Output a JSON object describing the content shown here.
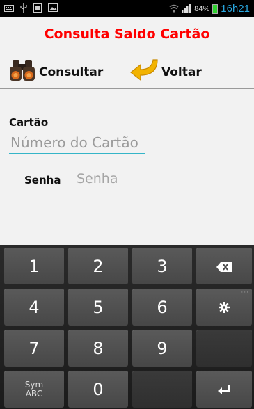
{
  "status_bar": {
    "battery_percent": "84%",
    "time": "16h21"
  },
  "app": {
    "title": "Consulta Saldo Cartão",
    "toolbar": {
      "consultar_label": "Consultar",
      "voltar_label": "Voltar"
    },
    "form": {
      "cartao_label": "Cartão",
      "cartao_placeholder": "Número do Cartão",
      "senha_label": "Senha",
      "senha_placeholder": "Senha"
    }
  },
  "keyboard": {
    "keys": {
      "k1": "1",
      "k2": "2",
      "k3": "3",
      "k4": "4",
      "k5": "5",
      "k6": "6",
      "k7": "7",
      "k8": "8",
      "k9": "9",
      "k0": "0",
      "sym_line1": "Sym",
      "sym_line2": "ABC"
    },
    "icons": [
      "backspace-icon",
      "settings-icon",
      "enter-icon"
    ]
  },
  "colors": {
    "title": "#ff0000",
    "input_focus": "#35b5c8",
    "clock": "#29a8e0"
  }
}
